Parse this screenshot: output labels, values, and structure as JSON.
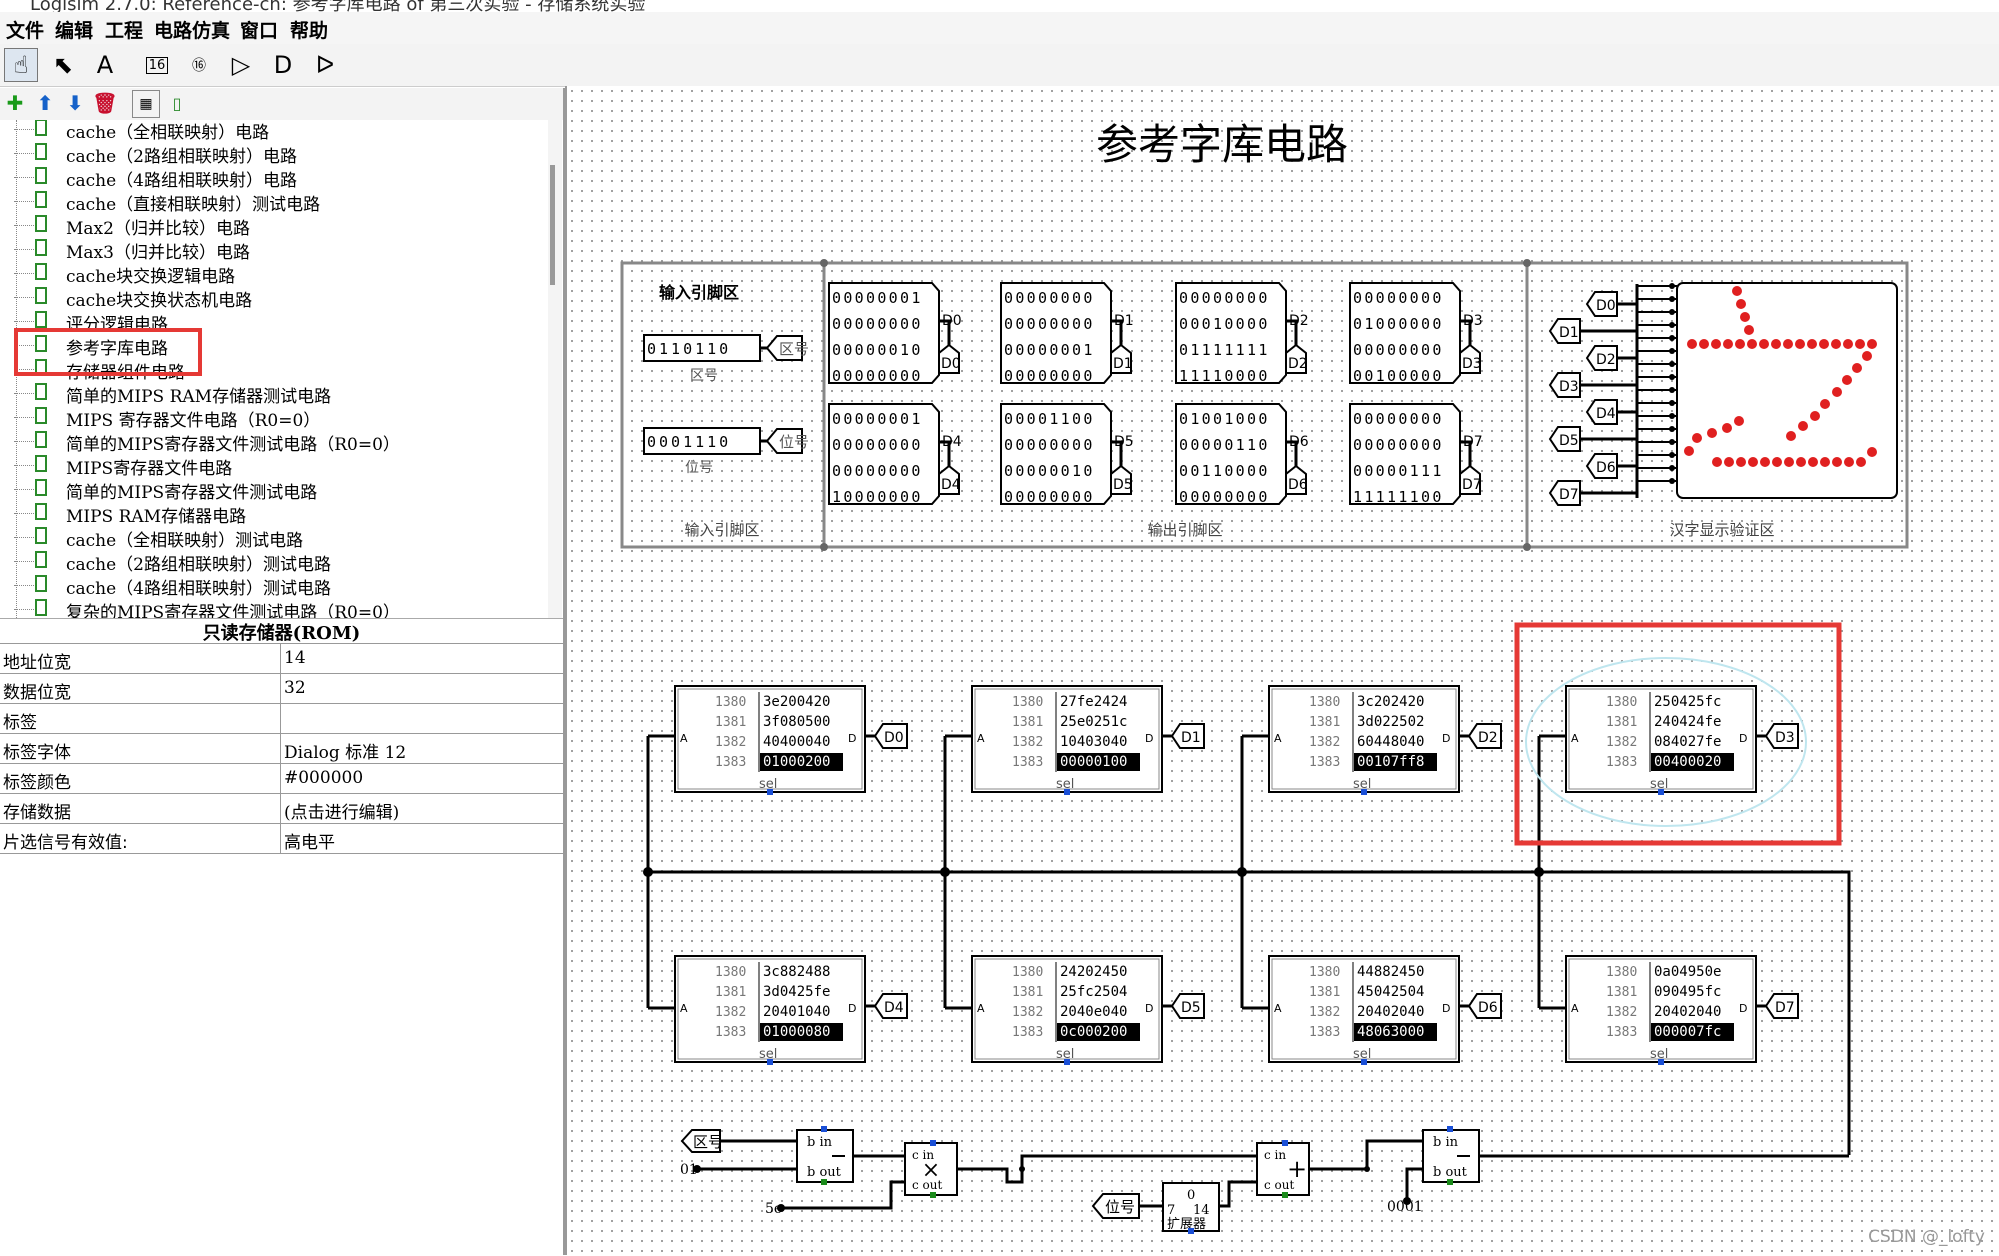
{
  "window": {
    "title": "Logisim 2.7.0: Reference-cn: 参考字库电路 of 第三次实验 - 存储系统实验"
  },
  "menu": [
    "文件",
    "编辑",
    "工程",
    "电路仿真",
    "窗口",
    "帮助"
  ],
  "tree": {
    "items": [
      "cache（全相联映射）电路",
      "cache（2路组相联映射）电路",
      "cache（4路组相联映射）电路",
      "cache（直接相联映射）测试电路",
      "Max2（归并比较）电路",
      "Max3（归并比较）电路",
      "cache块交换逻辑电路",
      "cache块交换状态机电路",
      "评分逻辑电路",
      "参考字库电路",
      "存储器组件电路",
      "简单的MIPS RAM存储器测试电路",
      "MIPS 寄存器文件电路（R0=0）",
      "简单的MIPS寄存器文件测试电路（R0=0）",
      "MIPS寄存器文件电路",
      "简单的MIPS寄存器文件测试电路",
      "MIPS RAM存储器电路",
      "cache（全相联映射）测试电路",
      "cache（2路组相联映射）测试电路",
      "cache（4路组相联映射）测试电路",
      "复杂的MIPS寄存器文件测试电路（R0=0）"
    ]
  },
  "props": {
    "title": "只读存储器(ROM)",
    "rows": [
      {
        "key": "地址位宽",
        "value": "14"
      },
      {
        "key": "数据位宽",
        "value": "32"
      },
      {
        "key": "标签",
        "value": ""
      },
      {
        "key": "标签字体",
        "value": "Dialog 标准 12"
      },
      {
        "key": "标签颜色",
        "value": "#000000"
      },
      {
        "key": "存储数据",
        "value": "(点击进行编辑)"
      },
      {
        "key": "片选信号有效值:",
        "value": "高电平"
      }
    ]
  },
  "circuit": {
    "title": "参考字库电路",
    "input_section": {
      "title": "输入引脚区",
      "footer": "输入引脚区",
      "area_value": "0110110",
      "area_tunnel": "区号",
      "area_label": "区号",
      "pos_value": "0001110",
      "pos_tunnel": "位号",
      "pos_label": "位号"
    },
    "output_section": {
      "footer": "输出引脚区",
      "pins": [
        {
          "rows": [
            "00000001",
            "00000000",
            "00000010",
            "00000000"
          ],
          "label": "D0"
        },
        {
          "rows": [
            "00000000",
            "00000000",
            "00000001",
            "00000000"
          ],
          "label": "D1"
        },
        {
          "rows": [
            "00000000",
            "00010000",
            "01111111",
            "11110000"
          ],
          "label": "D2"
        },
        {
          "rows": [
            "00000000",
            "01000000",
            "00000000",
            "00100000"
          ],
          "label": "D3"
        },
        {
          "rows": [
            "00000001",
            "00000000",
            "00000000",
            "10000000"
          ],
          "label": "D4"
        },
        {
          "rows": [
            "00001100",
            "00000000",
            "00000010",
            "00000000"
          ],
          "label": "D5"
        },
        {
          "rows": [
            "01001000",
            "00000110",
            "00110000",
            "00000000"
          ],
          "label": "D6"
        },
        {
          "rows": [
            "00000000",
            "00000000",
            "00000111",
            "11111100"
          ],
          "label": "D7"
        }
      ]
    },
    "display_section": {
      "footer": "汉字显示验证区",
      "inputs": [
        "D0",
        "D1",
        "D2",
        "D3",
        "D4",
        "D5",
        "D6",
        "D7"
      ]
    },
    "roms": [
      {
        "addrs": [
          "1380",
          "1381",
          "1382",
          "1383"
        ],
        "vals": [
          "3e200420",
          "3f080500",
          "40400040",
          "01000200"
        ],
        "out": "D0"
      },
      {
        "addrs": [
          "1380",
          "1381",
          "1382",
          "1383"
        ],
        "vals": [
          "27fe2424",
          "25e0251c",
          "10403040",
          "00000100"
        ],
        "out": "D1"
      },
      {
        "addrs": [
          "1380",
          "1381",
          "1382",
          "1383"
        ],
        "vals": [
          "3c202420",
          "3d022502",
          "60448040",
          "00107ff8"
        ],
        "out": "D2"
      },
      {
        "addrs": [
          "1380",
          "1381",
          "1382",
          "1383"
        ],
        "vals": [
          "250425fc",
          "240424fe",
          "084027fe",
          "00400020"
        ],
        "out": "D3"
      },
      {
        "addrs": [
          "1380",
          "1381",
          "1382",
          "1383"
        ],
        "vals": [
          "3c882488",
          "3d0425fe",
          "20401040",
          "01000080"
        ],
        "out": "D4"
      },
      {
        "addrs": [
          "1380",
          "1381",
          "1382",
          "1383"
        ],
        "vals": [
          "24202450",
          "25fc2504",
          "2040e040",
          "0c000200"
        ],
        "out": "D5"
      },
      {
        "addrs": [
          "1380",
          "1381",
          "1382",
          "1383"
        ],
        "vals": [
          "44882450",
          "45042504",
          "20402040",
          "48063000"
        ],
        "out": "D6"
      },
      {
        "addrs": [
          "1380",
          "1381",
          "1382",
          "1383"
        ],
        "vals": [
          "0a04950e",
          "090495fc",
          "20402040",
          "000007fc"
        ],
        "out": "D7"
      }
    ],
    "rom_labels": {
      "a": "A",
      "d": "D",
      "sel": "sel"
    },
    "bottom": {
      "area_tunnel": "区号",
      "const_01": "01",
      "const_5e": "5e",
      "pos_tunnel": "位号",
      "const_0001": "0001",
      "ext_top": "0",
      "ext_in": "7",
      "ext_out": "14",
      "ext_label": "扩展器",
      "sub_labels": [
        "b in",
        "b out"
      ],
      "mul_labels": [
        "c in",
        "c out"
      ],
      "add_labels": [
        "c in",
        "c out"
      ],
      "sub2_labels": [
        "b in",
        "b out"
      ],
      "mul_sym": "×",
      "add_sym": "+"
    }
  },
  "watermark": "CSDN @_lofty",
  "colors": {
    "highlight": "#e53935",
    "ellipse": "#bfe6ef",
    "led_on": "#e02020",
    "wire": "#000000"
  }
}
